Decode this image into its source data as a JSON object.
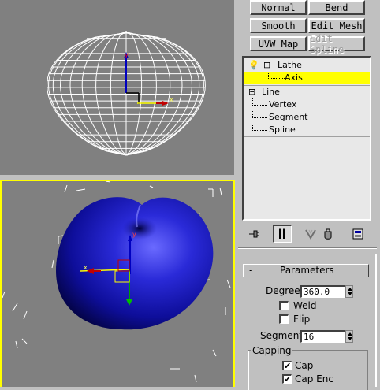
{
  "buttons": {
    "normal": "Normal",
    "bend": "Bend",
    "smooth": "Smooth",
    "edit_mesh": "Edit Mesh",
    "uvw_map": "UVW Map",
    "edit_spline": "Edit Spline"
  },
  "stack": {
    "items": [
      {
        "label": "Lathe",
        "expander": "⊟"
      },
      {
        "label": "Axis",
        "selected": true
      },
      {
        "label": "Line",
        "expander": "⊟"
      },
      {
        "label": "Vertex"
      },
      {
        "label": "Segment"
      },
      {
        "label": "Spline"
      }
    ]
  },
  "toolbar": {
    "icons": [
      "pin-stack-icon",
      "show-end-result-icon",
      "make-unique-icon",
      "remove-modifier-icon",
      "configure-modifier-sets-icon"
    ]
  },
  "parameters": {
    "title": "Parameters",
    "collapse": "-",
    "degrees_label": "Degrees:",
    "degrees_value": "360.0",
    "weld_label": "Weld",
    "weld_checked": false,
    "flip_label": "Flip",
    "flip_checked": false,
    "segments_label": "Segments:",
    "segments_value": "16",
    "capping_label": "Capping",
    "cap_start_label": "Cap",
    "cap_start_checked": "✔",
    "cap_end_label": "Cap Enc",
    "cap_end_checked": "✔"
  },
  "viewports": {
    "top_axis_x": "x",
    "top_axis_y": "y",
    "bottom_axis_x": "x",
    "bottom_axis_y": "y"
  },
  "colors": {
    "viewport_bg": "#808080",
    "active_border": "#ffff00",
    "mesh": "#1a1aa8",
    "selection": "#ffff00"
  }
}
